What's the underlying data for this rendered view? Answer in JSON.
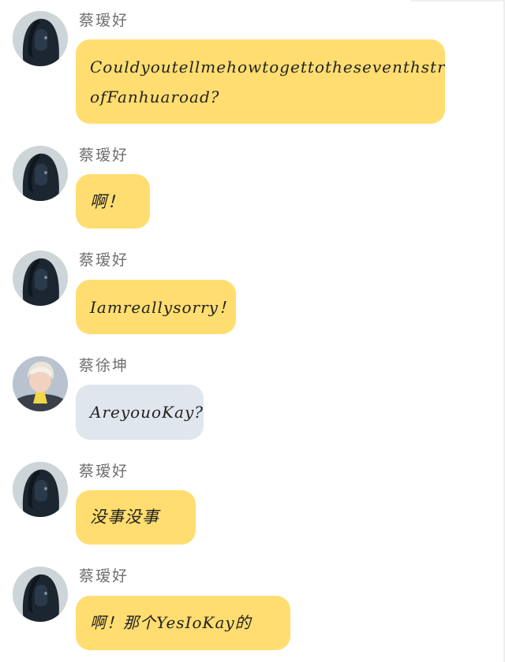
{
  "messages": [
    {
      "sender": "蔡瑷好",
      "avatar": "dark-haired-woman-avatar",
      "text_lines": [
        "Couldyoutellmehowtogettotheseventhstreet",
        "ofFanhuaroad?"
      ],
      "bubble_color": "#ffdd70"
    },
    {
      "sender": "蔡瑷好",
      "avatar": "dark-haired-woman-avatar",
      "text_lines": [
        "啊！"
      ],
      "bubble_color": "#ffdd70"
    },
    {
      "sender": "蔡瑷好",
      "avatar": "dark-haired-woman-avatar",
      "text_lines": [
        "Iamreallysorry！"
      ],
      "bubble_color": "#ffdd70"
    },
    {
      "sender": "蔡徐坤",
      "avatar": "blond-young-man-avatar",
      "text_lines": [
        "AreyouoKay?"
      ],
      "bubble_color": "#e0e6ee"
    },
    {
      "sender": "蔡瑷好",
      "avatar": "dark-haired-woman-avatar",
      "text_lines": [
        "没事没事"
      ],
      "bubble_color": "#ffdd70"
    },
    {
      "sender": "蔡瑷好",
      "avatar": "dark-haired-woman-avatar",
      "text_lines": [
        "啊！那个YesIoKay的"
      ],
      "bubble_color": "#ffdd70"
    }
  ]
}
